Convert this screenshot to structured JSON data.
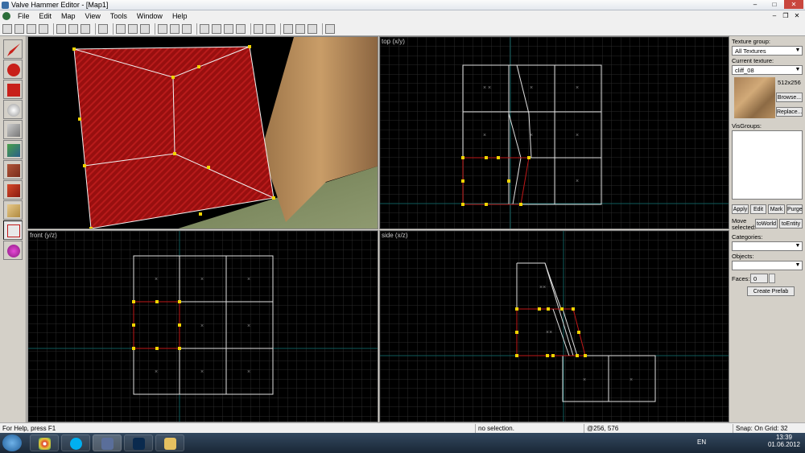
{
  "window": {
    "title": "Valve Hammer Editor - [Map1]"
  },
  "window_controls": {
    "minimize": "–",
    "maximize": "□",
    "close": "✕"
  },
  "mdi_controls": {
    "minimize": "–",
    "restore": "❐",
    "close": "✕"
  },
  "menu": [
    {
      "label": "File"
    },
    {
      "label": "Edit"
    },
    {
      "label": "Map"
    },
    {
      "label": "View"
    },
    {
      "label": "Tools"
    },
    {
      "label": "Window"
    },
    {
      "label": "Help"
    }
  ],
  "viewports": {
    "camera": {
      "label": ""
    },
    "top": {
      "label": "top (x/y)"
    },
    "front": {
      "label": "front (y/z)"
    },
    "side": {
      "label": "side (x/z)"
    }
  },
  "side_panel": {
    "texture_group_label": "Texture group:",
    "texture_group_value": "All Textures",
    "current_texture_label": "Current texture:",
    "current_texture_value": "cliff_08",
    "texture_size": "512x256",
    "browse_button": "Browse...",
    "replace_button": "Replace...",
    "visgroups_label": "VisGroups:",
    "apply_button": "Apply",
    "edit_button": "Edit",
    "mark_button": "Mark",
    "purge_button": "Purge",
    "move_selected_label_1": "Move",
    "move_selected_label_2": "selected:",
    "to_world_button": "toWorld",
    "to_entity_button": "toEntity",
    "categories_label": "Categories:",
    "objects_label": "Objects:",
    "faces_label": "Faces:",
    "faces_value": "0",
    "create_prefab_button": "Create Prefab"
  },
  "statusbar": {
    "help": "For Help, press F1",
    "selection": "no selection.",
    "coords": "@256, 576",
    "snap": "Snap: On Grid: 32"
  },
  "taskbar": {
    "lang": "EN",
    "time": "13:39",
    "date": "01.06.2012"
  },
  "colors": {
    "grid": "#2b2b2b",
    "grid_major": "#3d3d3d",
    "axis": "#0e5d5d",
    "brush": "#e8e8e8",
    "selected": "#c01818",
    "handle": "#f0d400"
  }
}
